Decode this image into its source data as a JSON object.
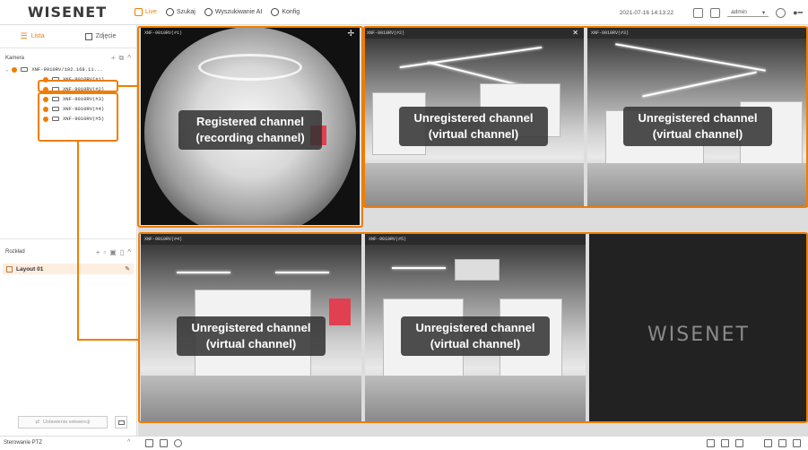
{
  "app": {
    "brand": "WISENET"
  },
  "topnav": [
    {
      "label": "Live",
      "icon": "monitor-icon",
      "active": true
    },
    {
      "label": "Szukaj",
      "icon": "search-icon",
      "active": false
    },
    {
      "label": "Wyszukiwanie AI",
      "icon": "ai-search-icon",
      "active": false
    },
    {
      "label": "Konfig",
      "icon": "gear-icon",
      "active": false
    }
  ],
  "status": {
    "datetime": "2021-07-16 14:13:22",
    "user": "admin"
  },
  "sidebar": {
    "tabs": {
      "list": "Lista",
      "image": "Zdjęcie"
    },
    "camera_section": "Kamera",
    "recorder": "XNF-9010RV/192.168.11...",
    "channels": [
      "XNF-9010RV(#1)",
      "XNF-9010RV(#2)",
      "XNF-9010RV(#3)",
      "XNF-9010RV(#4)",
      "XNF-9010RV(#5)"
    ],
    "layout_section": "Rozkład",
    "layouts": [
      "Layout 01"
    ],
    "sequence_button": "Ustawienia sekwencji"
  },
  "bottombar": {
    "ptz": "Sterowanie PTZ"
  },
  "tiles": [
    {
      "caption": "XNF-9010RV(#1)",
      "label1": "Registered channel",
      "label2": "(recording channel)"
    },
    {
      "caption": "XNF-9010RV(#2)",
      "label1": "Unregistered channel",
      "label2": "(virtual channel)"
    },
    {
      "caption": "XNF-9010RV(#3)",
      "label1": "Unregistered channel",
      "label2": "(virtual channel)"
    },
    {
      "caption": "XNF-9010RV(#4)",
      "label1": "Unregistered channel",
      "label2": "(virtual channel)"
    },
    {
      "caption": "XNF-9010RV(#5)",
      "label1": "Unregistered channel",
      "label2": "(virtual channel)"
    }
  ],
  "empty_tile_brand": "WISENET",
  "colors": {
    "accent": "#f07d00",
    "highlight_row": "#fdeee0"
  }
}
